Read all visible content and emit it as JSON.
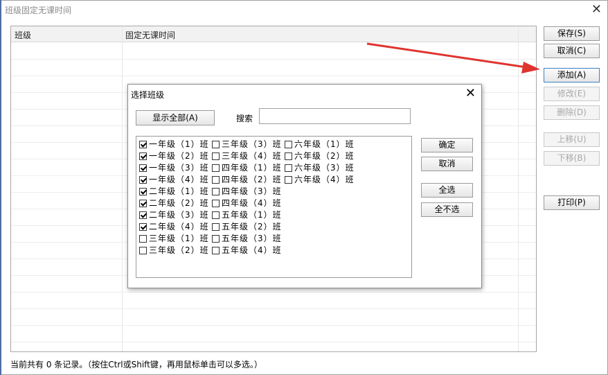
{
  "window": {
    "title": "班级固定无课时间",
    "close_glyph": "✕"
  },
  "grid": {
    "columns": [
      "班级",
      "固定无课时间"
    ]
  },
  "side_buttons": [
    {
      "label": "保存(S)",
      "enabled": true
    },
    {
      "label": "取消(C)",
      "enabled": true
    },
    {
      "label": "添加(A)",
      "enabled": true
    },
    {
      "label": "修改(E)",
      "enabled": false
    },
    {
      "label": "删除(D)",
      "enabled": false
    },
    {
      "label": "上移(U)",
      "enabled": false
    },
    {
      "label": "下移(B)",
      "enabled": false
    },
    {
      "label": "打印(P)",
      "enabled": true
    }
  ],
  "status": {
    "text": "当前共有 0 条记录。（按住Ctrl或Shift键，再用鼠标单击可以多选。）"
  },
  "dialog": {
    "title": "选择班级",
    "close_glyph": "✕",
    "show_all_label": "显示全部(A)",
    "search_label": "搜索",
    "search_value": "",
    "confirm_label": "确定",
    "cancel_label": "取消",
    "select_all_label": "全选",
    "select_none_label": "全不选",
    "columns": [
      [
        {
          "label": "一年级（1）班",
          "checked": true
        },
        {
          "label": "一年级（2）班",
          "checked": true
        },
        {
          "label": "一年级（3）班",
          "checked": true
        },
        {
          "label": "一年级（4）班",
          "checked": true
        },
        {
          "label": "二年级（1）班",
          "checked": true
        },
        {
          "label": "二年级（2）班",
          "checked": true
        },
        {
          "label": "二年级（3）班",
          "checked": true
        },
        {
          "label": "二年级（4）班",
          "checked": true
        },
        {
          "label": "三年级（1）班",
          "checked": false
        },
        {
          "label": "三年级（2）班",
          "checked": false
        }
      ],
      [
        {
          "label": "三年级（3）班",
          "checked": false
        },
        {
          "label": "三年级（4）班",
          "checked": false
        },
        {
          "label": "四年级（1）班",
          "checked": false
        },
        {
          "label": "四年级（2）班",
          "checked": false
        },
        {
          "label": "四年级（3）班",
          "checked": false
        },
        {
          "label": "四年级（4）班",
          "checked": false
        },
        {
          "label": "五年级（1）班",
          "checked": false
        },
        {
          "label": "五年级（2）班",
          "checked": false
        },
        {
          "label": "五年级（3）班",
          "checked": false
        },
        {
          "label": "五年级（4）班",
          "checked": false
        }
      ],
      [
        {
          "label": "六年级（1）班",
          "checked": false
        },
        {
          "label": "六年级（2）班",
          "checked": false
        },
        {
          "label": "六年级（3）班",
          "checked": false
        },
        {
          "label": "六年级（4）班",
          "checked": false
        }
      ]
    ]
  },
  "colors": {
    "annotation_red": "#e0342f",
    "checkbox_border": "#333333",
    "focused_button_border": "#3c7fc4"
  }
}
